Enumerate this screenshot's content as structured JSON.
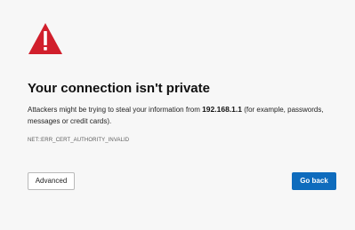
{
  "error_page": {
    "icon": "warning-triangle-icon",
    "accent_color": "#d11f2c",
    "title": "Your connection isn't private",
    "message_before_host": "Attackers might be trying to steal your information from ",
    "host": "192.168.1.1",
    "message_after_host": " (for example, passwords, messages or credit cards).",
    "error_code": "NET::ERR_CERT_AUTHORITY_INVALID",
    "buttons": {
      "advanced_label": "Advanced",
      "go_back_label": "Go back"
    },
    "button_colors": {
      "primary": "#0f6cbd",
      "secondary": "#ffffff"
    }
  }
}
